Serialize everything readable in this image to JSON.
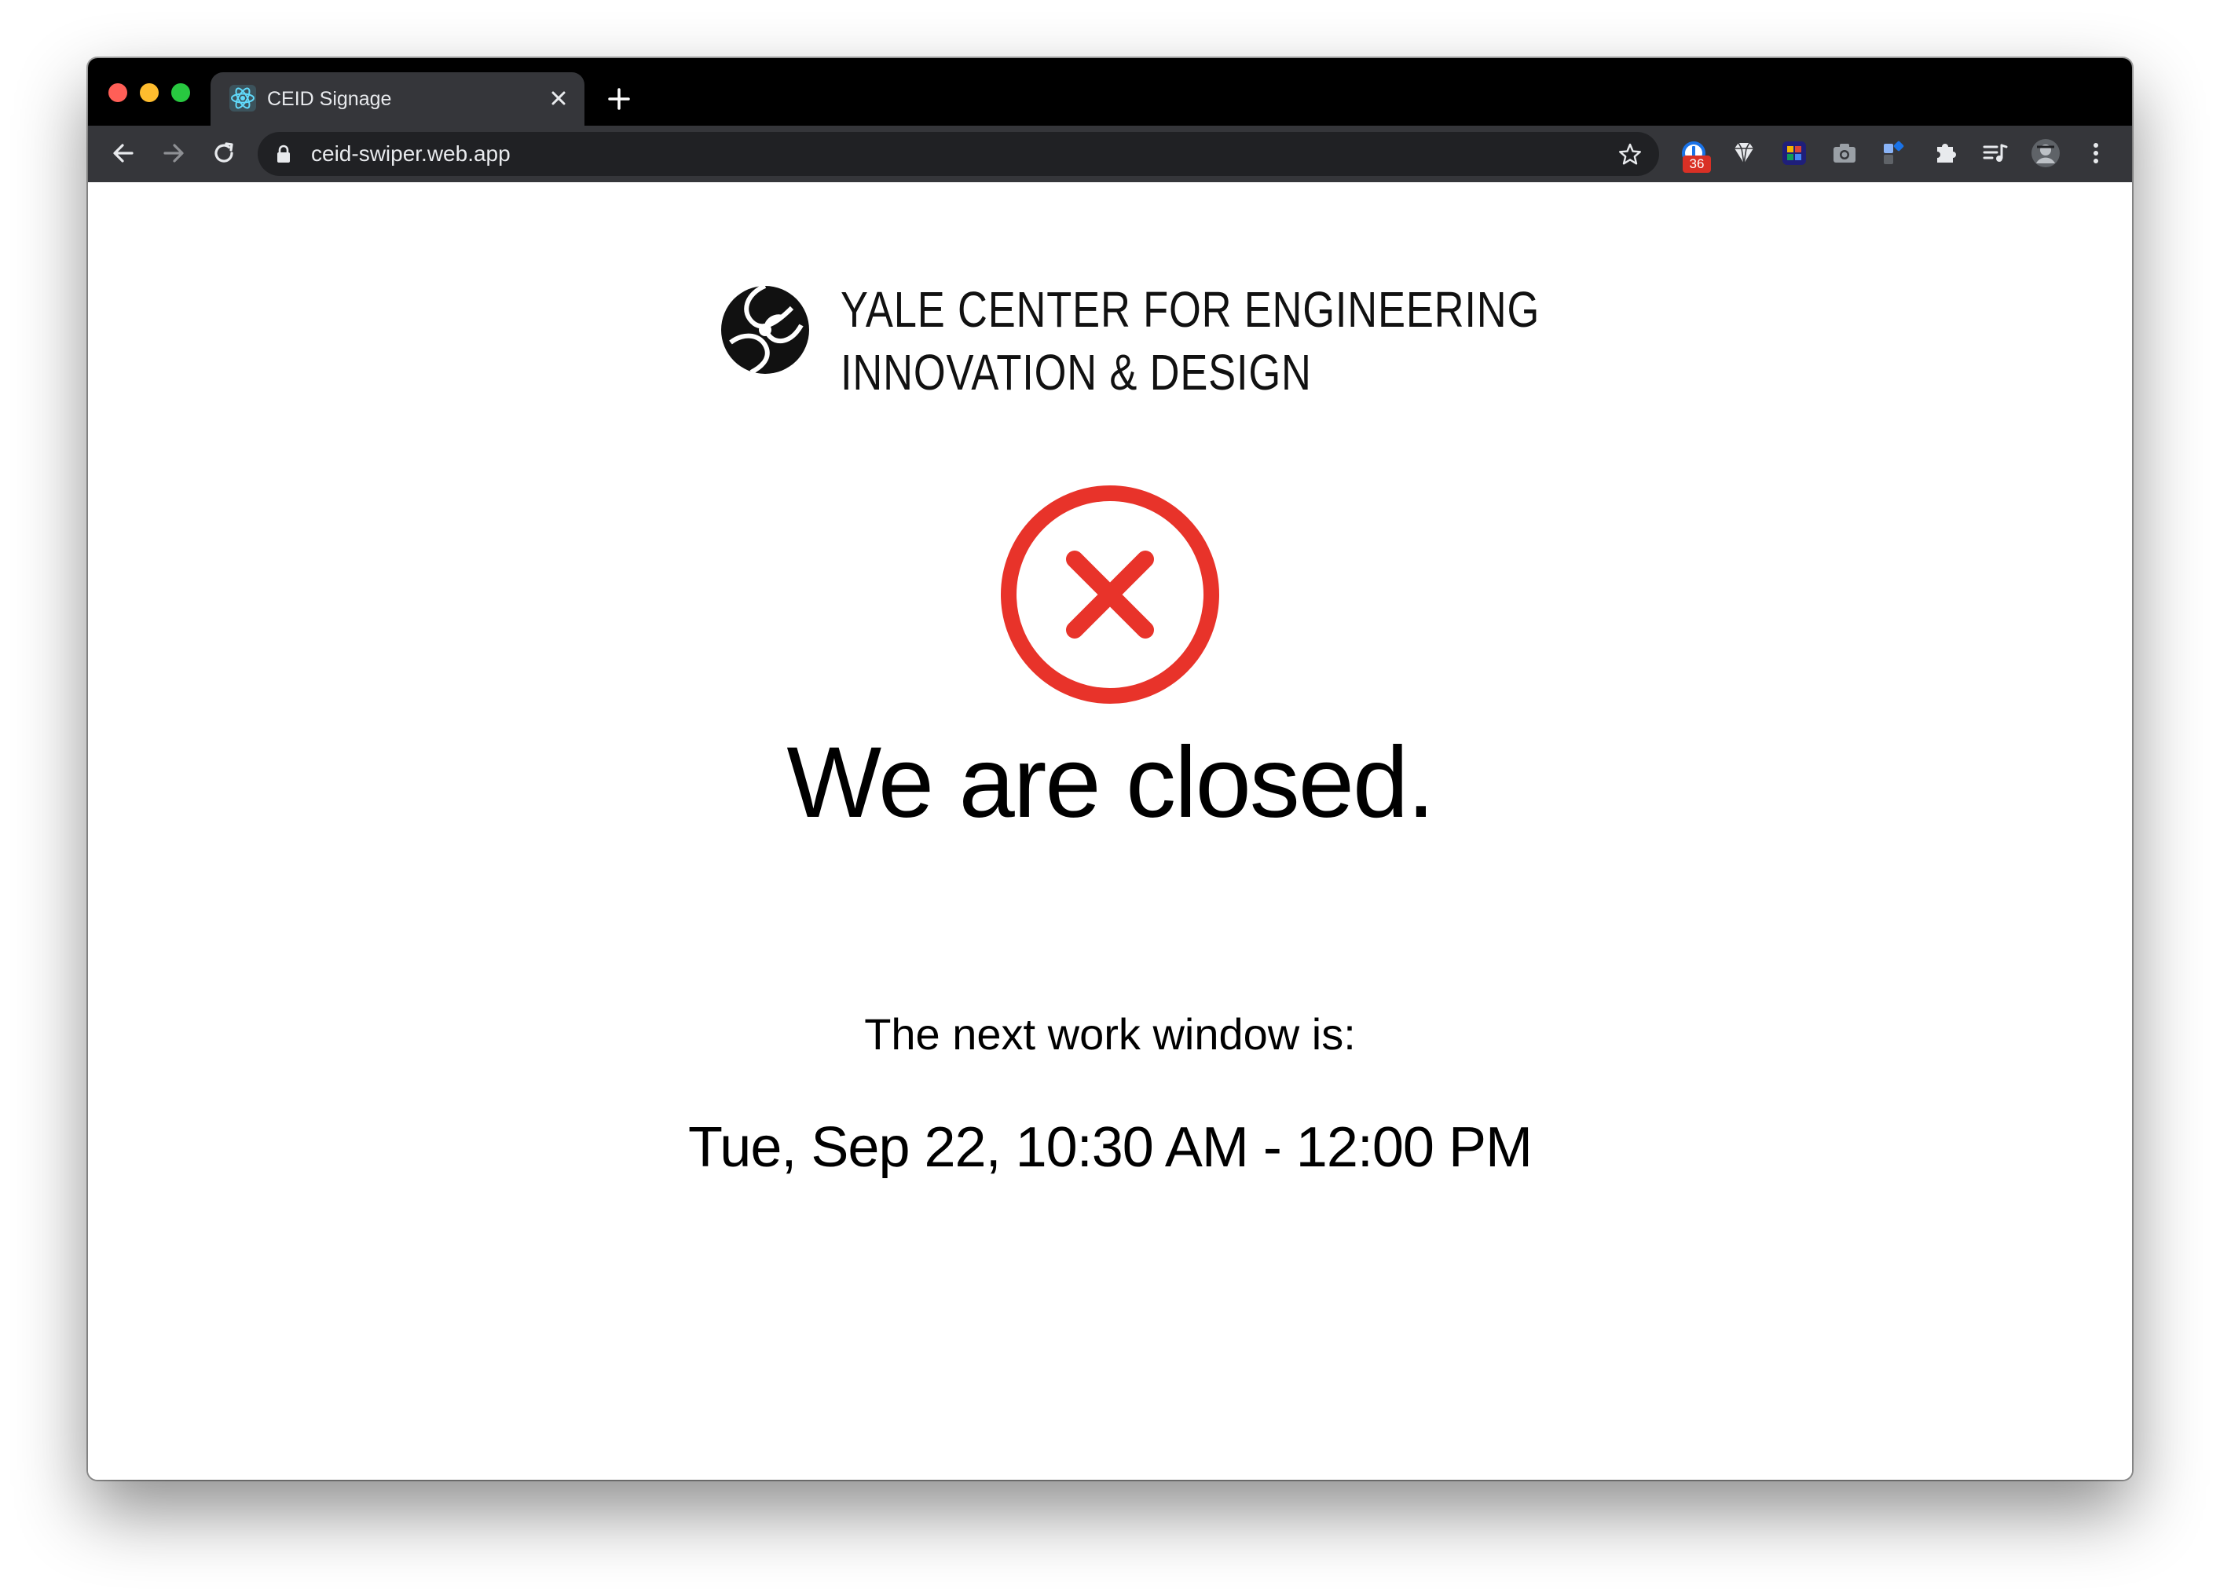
{
  "browser": {
    "tab": {
      "title": "CEID Signage",
      "favicon": "react-atom-icon"
    },
    "address_bar": {
      "url": "ceid-swiper.web.app",
      "secure_icon": "lock-icon"
    },
    "extensions_badge": "36"
  },
  "page": {
    "logo": {
      "line1": "YALE CENTER FOR ENGINEERING",
      "line2": "INNOVATION & DESIGN"
    },
    "status_icon": "closed-x-icon",
    "status_color": "#e8332a",
    "headline": "We are closed.",
    "next_label": "The next work window is:",
    "next_window": "Tue, Sep 22, 10:30 AM - 12:00 PM"
  }
}
